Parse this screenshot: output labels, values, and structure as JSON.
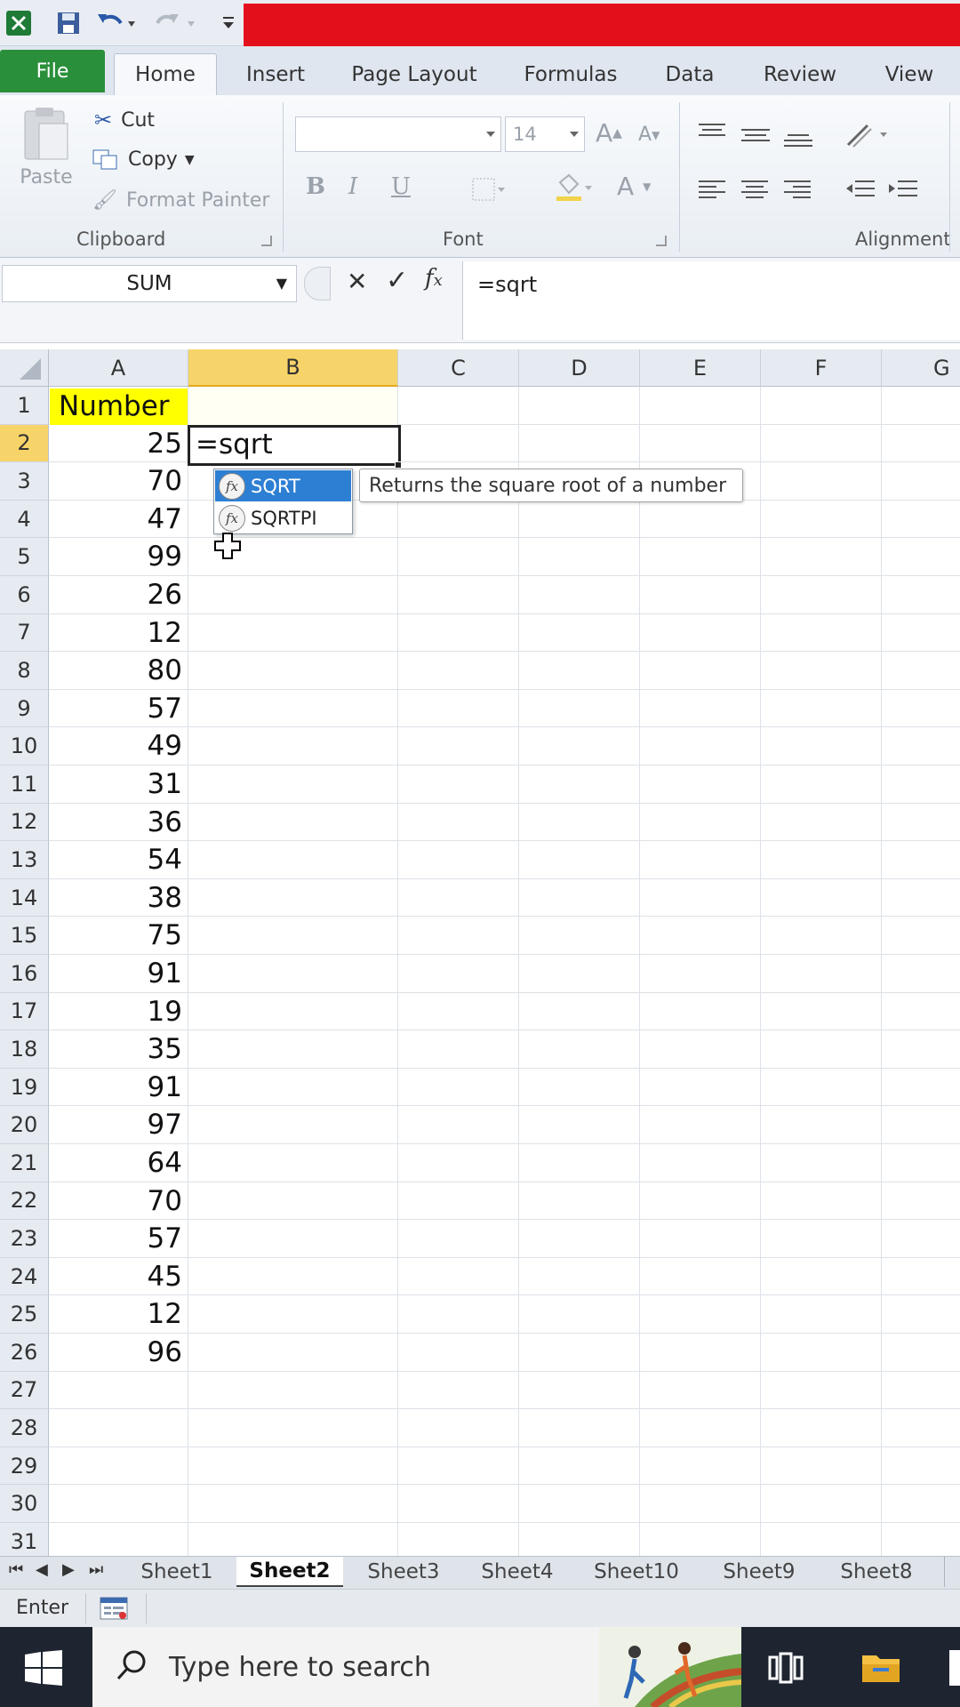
{
  "tabs": [
    "File",
    "Home",
    "Insert",
    "Page Layout",
    "Formulas",
    "Data",
    "Review",
    "View"
  ],
  "clipboard": {
    "paste": "Paste",
    "cut": "Cut",
    "copy": "Copy",
    "format_painter": "Format Painter",
    "label": "Clipboard"
  },
  "font": {
    "size": "14",
    "label": "Font",
    "bold": "B",
    "italic": "I",
    "underline": "U"
  },
  "alignment": {
    "label": "Alignment"
  },
  "formula_bar": {
    "name_box": "SUM",
    "value": "=sqrt"
  },
  "columns": [
    "A",
    "B",
    "C",
    "D",
    "E",
    "F",
    "G"
  ],
  "rows": [
    "1",
    "2",
    "3",
    "4",
    "5",
    "6",
    "7",
    "8",
    "9",
    "10",
    "11",
    "12",
    "13",
    "14",
    "15",
    "16",
    "17",
    "18",
    "19",
    "20",
    "21",
    "22",
    "23",
    "24",
    "25",
    "26",
    "27",
    "28",
    "29",
    "30",
    "31"
  ],
  "cells": {
    "A1": "Number",
    "B2": "=sqrt",
    "A_values": [
      "25",
      "70",
      "47",
      "99",
      "26",
      "12",
      "80",
      "57",
      "49",
      "31",
      "36",
      "54",
      "38",
      "75",
      "91",
      "19",
      "35",
      "91",
      "97",
      "64",
      "70",
      "57",
      "45",
      "12",
      "96"
    ]
  },
  "autocomplete": {
    "items": [
      "SQRT",
      "SQRTPI"
    ],
    "selected_index": 0,
    "tooltip": "Returns the square root of a number",
    "fx_glyph": "fx"
  },
  "sheet_tabs": [
    "Sheet1",
    "Sheet2",
    "Sheet3",
    "Sheet4",
    "Sheet10",
    "Sheet9",
    "Sheet8"
  ],
  "active_sheet": "Sheet2",
  "status": {
    "mode": "Enter"
  },
  "taskbar": {
    "search_placeholder": "Type here to search"
  },
  "colors": {
    "header_yellow": "#ffff00",
    "selection_blue": "#2d7fd3",
    "file_tab": "#2a8f3a",
    "title_red": "#e3101b"
  }
}
